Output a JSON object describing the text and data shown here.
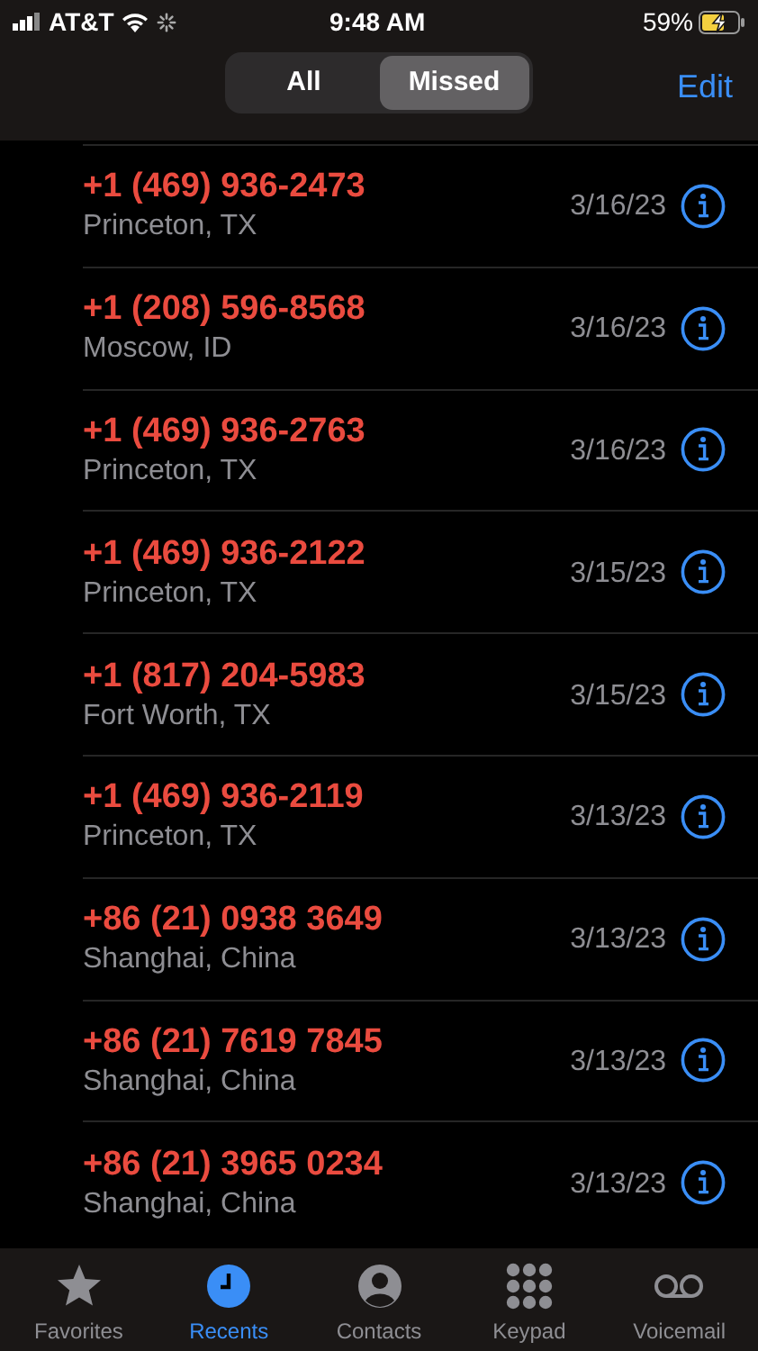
{
  "status_bar": {
    "carrier": "AT&T",
    "time": "9:48 AM",
    "battery": "59%",
    "charging": true
  },
  "header": {
    "segments": [
      {
        "label": "All",
        "selected": false
      },
      {
        "label": "Missed",
        "selected": true
      }
    ],
    "edit": "Edit"
  },
  "calls": [
    {
      "number": "+1 (469) 936-2473",
      "location": "Princeton, TX",
      "date": "3/16/23",
      "missed": true
    },
    {
      "number": "+1 (208) 596-8568",
      "location": "Moscow, ID",
      "date": "3/16/23",
      "missed": true
    },
    {
      "number": "+1 (469) 936-2763",
      "location": "Princeton, TX",
      "date": "3/16/23",
      "missed": true
    },
    {
      "number": "+1 (469) 936-2122",
      "location": "Princeton, TX",
      "date": "3/15/23",
      "missed": true
    },
    {
      "number": "+1 (817) 204-5983",
      "location": "Fort Worth, TX",
      "date": "3/15/23",
      "missed": true
    },
    {
      "number": "+1 (469) 936-2119",
      "location": "Princeton, TX",
      "date": "3/13/23",
      "missed": true
    },
    {
      "number": "+86 (21) 0938 3649",
      "location": "Shanghai, China",
      "date": "3/13/23",
      "missed": true
    },
    {
      "number": "+86 (21) 7619 7845",
      "location": "Shanghai, China",
      "date": "3/13/23",
      "missed": true
    },
    {
      "number": "+86 (21) 3965 0234",
      "location": "Shanghai, China",
      "date": "3/13/23",
      "missed": true
    }
  ],
  "tab_bar": [
    {
      "kind": "favorites",
      "label": "Favorites",
      "selected": false
    },
    {
      "kind": "recents",
      "label": "Recents",
      "selected": true
    },
    {
      "kind": "contacts",
      "label": "Contacts",
      "selected": false
    },
    {
      "kind": "keypad",
      "label": "Keypad",
      "selected": false
    },
    {
      "kind": "voicemail",
      "label": "Voicemail",
      "selected": false
    }
  ]
}
